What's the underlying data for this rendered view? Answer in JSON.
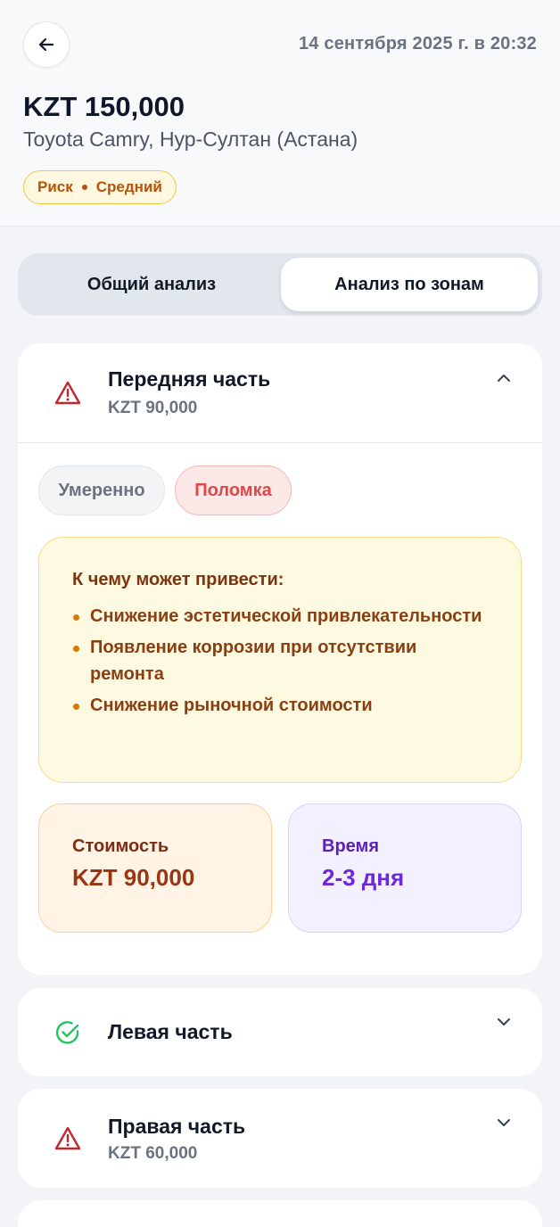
{
  "header": {
    "datetime": "14 сентября 2025 г. в 20:32",
    "price": "KZT 150,000",
    "car": "Toyota Camry, Нур-Султан (Астана)",
    "risk": {
      "label": "Риск",
      "level": "Средний"
    }
  },
  "tabs": [
    {
      "label": "Общий анализ",
      "active": false
    },
    {
      "label": "Анализ по зонам",
      "active": true
    }
  ],
  "zones": [
    {
      "title": "Передняя часть",
      "amount": "KZT 90,000",
      "status_icon": "warning-icon",
      "expanded": true,
      "chips": [
        "Умеренно",
        "Поломка"
      ],
      "consequences_title": "К чему может привести:",
      "consequences": [
        "Снижение эстетической привлекательности",
        "Появление коррозии при отсутствии ремонта",
        "Снижение рыночной стоимости"
      ],
      "cost_label": "Стоимость",
      "cost_value": "KZT 90,000",
      "time_label": "Время",
      "time_value": "2-3 дня"
    },
    {
      "title": "Левая часть",
      "status_icon": "check-circle-icon",
      "expanded": false
    },
    {
      "title": "Правая часть",
      "amount": "KZT 60,000",
      "status_icon": "warning-icon",
      "expanded": false
    }
  ],
  "colors": {
    "warning": "#c0262d",
    "ok": "#22c55e",
    "risk_badge": "#b45309",
    "active_tab_bg": "#ffffff",
    "tab_track": "#e2e6ed"
  }
}
